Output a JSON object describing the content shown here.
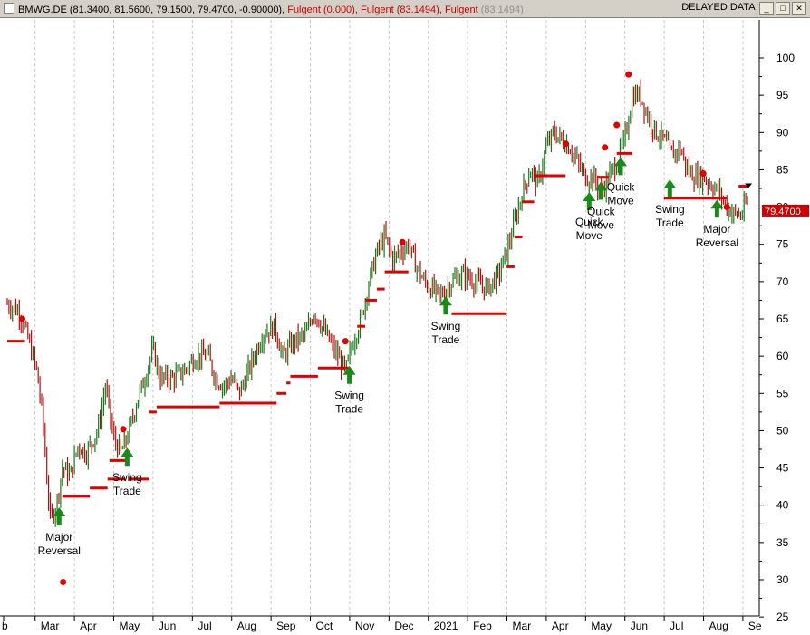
{
  "header": {
    "symbol": "BMWG.DE",
    "ohlc": "(81.3400, 81.5600, 79.1500, 79.4700, -0.90000),",
    "indicators": [
      {
        "name": "Fulgent",
        "value": "(0.000),",
        "color": "#cc0000"
      },
      {
        "name": "Fulgent",
        "value": "(83.1494),",
        "color": "#cc0000"
      },
      {
        "name": "Fulgent",
        "value": "(83.1494)",
        "color": "#909090"
      }
    ],
    "status": "DELAYED DATA",
    "window_buttons": [
      "_",
      "□",
      "✕"
    ]
  },
  "colors": {
    "up_bar": "#1a7a1a",
    "down_bar": "#b01010",
    "stop_line": "#e00000",
    "signal_dot": "#e00000",
    "signal_arrow": "#1a8a1a",
    "grid": "#c8c8c8",
    "last_price_bg": "#cc0000"
  },
  "chart_data": {
    "type": "ohlc",
    "y_ticks": [
      25,
      30,
      35,
      40,
      45,
      50,
      55,
      60,
      65,
      70,
      75,
      80,
      85,
      90,
      95,
      100
    ],
    "ylim": [
      22.5,
      105
    ],
    "x_ticks": [
      "b",
      "Mar",
      "Apr",
      "May",
      "Jun",
      "Jul",
      "Aug",
      "Sep",
      "Oct",
      "Nov",
      "Dec",
      "2021",
      "Feb",
      "Mar",
      "Apr",
      "May",
      "Jun",
      "Jul",
      "Aug",
      "Se"
    ],
    "x_tick_index": [
      0,
      0.8,
      1.8,
      2.8,
      3.8,
      4.8,
      5.8,
      6.8,
      7.8,
      8.8,
      9.8,
      10.8,
      11.8,
      12.8,
      13.8,
      14.8,
      15.8,
      16.8,
      17.8,
      18.8
    ],
    "last_price": "79.4700",
    "price_path": [
      [
        0,
        67
      ],
      [
        0.3,
        66
      ],
      [
        0.55,
        62
      ],
      [
        0.75,
        58
      ],
      [
        0.9,
        52
      ],
      [
        1.0,
        44
      ],
      [
        1.1,
        38
      ],
      [
        1.25,
        40
      ],
      [
        1.4,
        45
      ],
      [
        1.6,
        44
      ],
      [
        1.8,
        48
      ],
      [
        2.0,
        47
      ],
      [
        2.3,
        50
      ],
      [
        2.5,
        56
      ],
      [
        2.7,
        49
      ],
      [
        2.9,
        47
      ],
      [
        3.1,
        50
      ],
      [
        3.3,
        54
      ],
      [
        3.5,
        57
      ],
      [
        3.7,
        61
      ],
      [
        3.9,
        57
      ],
      [
        4.2,
        57
      ],
      [
        4.5,
        58
      ],
      [
        4.8,
        60
      ],
      [
        5.1,
        60
      ],
      [
        5.3,
        57
      ],
      [
        5.5,
        56
      ],
      [
        5.7,
        57
      ],
      [
        5.9,
        55
      ],
      [
        6.2,
        59
      ],
      [
        6.5,
        63
      ],
      [
        6.8,
        64
      ],
      [
        7.0,
        60
      ],
      [
        7.3,
        62
      ],
      [
        7.6,
        63
      ],
      [
        7.8,
        66
      ],
      [
        8.0,
        64
      ],
      [
        8.2,
        62
      ],
      [
        8.4,
        60
      ],
      [
        8.6,
        58
      ],
      [
        8.8,
        62
      ],
      [
        9.0,
        65
      ],
      [
        9.2,
        70
      ],
      [
        9.4,
        74
      ],
      [
        9.6,
        76
      ],
      [
        9.8,
        73
      ],
      [
        10.0,
        74
      ],
      [
        10.2,
        75
      ],
      [
        10.4,
        72
      ],
      [
        10.6,
        70
      ],
      [
        10.8,
        69
      ],
      [
        11.0,
        68
      ],
      [
        11.3,
        70
      ],
      [
        11.6,
        71
      ],
      [
        11.9,
        70
      ],
      [
        12.2,
        69
      ],
      [
        12.5,
        71
      ],
      [
        12.7,
        74
      ],
      [
        12.9,
        78
      ],
      [
        13.1,
        82
      ],
      [
        13.3,
        85
      ],
      [
        13.5,
        83
      ],
      [
        13.7,
        88
      ],
      [
        13.9,
        90
      ],
      [
        14.1,
        89
      ],
      [
        14.3,
        88
      ],
      [
        14.5,
        86
      ],
      [
        14.7,
        84
      ],
      [
        14.9,
        84
      ],
      [
        15.1,
        82
      ],
      [
        15.3,
        84
      ],
      [
        15.5,
        86
      ],
      [
        15.7,
        89
      ],
      [
        15.9,
        95
      ],
      [
        16.1,
        95
      ],
      [
        16.3,
        92
      ],
      [
        16.5,
        90
      ],
      [
        16.7,
        89
      ],
      [
        16.9,
        87
      ],
      [
        17.1,
        88
      ],
      [
        17.3,
        85
      ],
      [
        17.5,
        84
      ],
      [
        17.7,
        84
      ],
      [
        17.9,
        83
      ],
      [
        18.1,
        82
      ],
      [
        18.3,
        80
      ],
      [
        18.5,
        79
      ],
      [
        18.7,
        79
      ],
      [
        18.8,
        81
      ],
      [
        18.85,
        79.47
      ]
    ],
    "stop_segments": [
      {
        "x0": 0.0,
        "x1": 0.45,
        "y": 62
      },
      {
        "x0": 1.4,
        "x1": 2.1,
        "y": 41.2
      },
      {
        "x0": 2.1,
        "x1": 2.55,
        "y": 42.3
      },
      {
        "x0": 2.55,
        "x1": 3.0,
        "y": 43.5
      },
      {
        "x0": 2.6,
        "x1": 3.0,
        "y": 46
      },
      {
        "x0": 3.1,
        "x1": 3.6,
        "y": 43.5
      },
      {
        "x0": 3.6,
        "x1": 3.8,
        "y": 52.5
      },
      {
        "x0": 3.8,
        "x1": 5.4,
        "y": 53.2
      },
      {
        "x0": 5.4,
        "x1": 6.85,
        "y": 53.7
      },
      {
        "x0": 6.85,
        "x1": 7.1,
        "y": 55
      },
      {
        "x0": 7.1,
        "x1": 7.2,
        "y": 56.4
      },
      {
        "x0": 7.2,
        "x1": 7.9,
        "y": 57.3
      },
      {
        "x0": 7.9,
        "x1": 8.7,
        "y": 58.4
      },
      {
        "x0": 8.9,
        "x1": 9.1,
        "y": 64
      },
      {
        "x0": 9.1,
        "x1": 9.4,
        "y": 67.5
      },
      {
        "x0": 9.4,
        "x1": 9.6,
        "y": 69
      },
      {
        "x0": 9.6,
        "x1": 10.2,
        "y": 71.3
      },
      {
        "x0": 11.3,
        "x1": 12.7,
        "y": 65.7
      },
      {
        "x0": 12.7,
        "x1": 12.9,
        "y": 72
      },
      {
        "x0": 12.9,
        "x1": 13.1,
        "y": 76
      },
      {
        "x0": 13.1,
        "x1": 13.4,
        "y": 80.7
      },
      {
        "x0": 13.4,
        "x1": 13.8,
        "y": 84.2
      },
      {
        "x0": 13.8,
        "x1": 14.2,
        "y": 84.2
      },
      {
        "x0": 15.0,
        "x1": 15.3,
        "y": 84
      },
      {
        "x0": 15.5,
        "x1": 15.9,
        "y": 87.2
      },
      {
        "x0": 16.7,
        "x1": 17.8,
        "y": 81.2
      },
      {
        "x0": 17.8,
        "x1": 18.3,
        "y": 81.2
      },
      {
        "x0": 18.6,
        "x1": 18.85,
        "y": 82.8
      }
    ],
    "red_dots": [
      {
        "x": 0.38,
        "y": 65
      },
      {
        "x": 1.42,
        "y": 29.7
      },
      {
        "x": 2.95,
        "y": 50.2
      },
      {
        "x": 8.6,
        "y": 62
      },
      {
        "x": 10.05,
        "y": 75.3
      },
      {
        "x": 14.2,
        "y": 88.5
      },
      {
        "x": 15.2,
        "y": 88
      },
      {
        "x": 15.5,
        "y": 91
      },
      {
        "x": 15.8,
        "y": 97.8
      },
      {
        "x": 17.7,
        "y": 84.5
      },
      {
        "x": 18.3,
        "y": 80
      }
    ],
    "signals": [
      {
        "x": 1.32,
        "y": 38.5,
        "line1": "Major",
        "line2": "Reversal"
      },
      {
        "x": 3.05,
        "y": 46.5,
        "line1": "Swing",
        "line2": "Trade"
      },
      {
        "x": 8.7,
        "y": 57.5,
        "line1": "Swing",
        "line2": "Trade"
      },
      {
        "x": 11.15,
        "y": 66.8,
        "line1": "Swing",
        "line2": "Trade"
      },
      {
        "x": 14.8,
        "y": 80.8,
        "line1": "Quick",
        "line2": "Move"
      },
      {
        "x": 15.1,
        "y": 82.2,
        "line1": "Quick",
        "line2": "Move"
      },
      {
        "x": 15.6,
        "y": 85.5,
        "line1": "Quick",
        "line2": "Move"
      },
      {
        "x": 16.85,
        "y": 82.5,
        "line1": "Swing",
        "line2": "Trade"
      },
      {
        "x": 18.05,
        "y": 79.8,
        "line1": "Major",
        "line2": "Reversal"
      }
    ]
  }
}
